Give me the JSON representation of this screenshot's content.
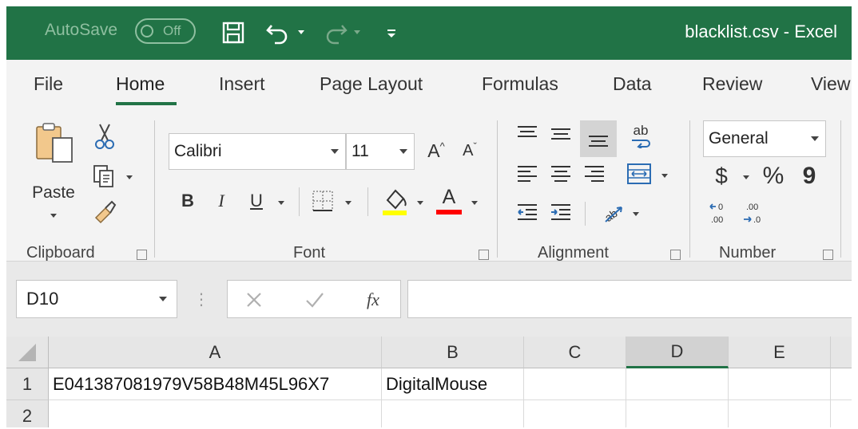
{
  "titlebar": {
    "autosave_label": "AutoSave",
    "autosave_state": "Off",
    "document_title": "blacklist.csv  -  Excel"
  },
  "tabs": [
    "File",
    "Home",
    "Insert",
    "Page Layout",
    "Formulas",
    "Data",
    "Review",
    "View"
  ],
  "active_tab": "Home",
  "ribbon": {
    "clipboard": {
      "paste_label": "Paste",
      "group_label": "Clipboard"
    },
    "font": {
      "font_name": "Calibri",
      "font_size": "11",
      "group_label": "Font",
      "bold": "B",
      "italic": "I",
      "underline": "U",
      "font_color_glyph": "A",
      "grow_glyph": "A",
      "shrink_glyph": "A",
      "highlight_color": "#ffff00",
      "font_color": "#ff0000"
    },
    "alignment": {
      "group_label": "Alignment",
      "wrap_glyph": "ab"
    },
    "number": {
      "format": "General",
      "group_label": "Number",
      "currency": "$",
      "percent": "%",
      "comma": "9"
    }
  },
  "formula_bar": {
    "name_box": "D10",
    "fx_label": "fx",
    "formula": ""
  },
  "sheet": {
    "columns": [
      "A",
      "B",
      "C",
      "D",
      "E"
    ],
    "selected_column": "D",
    "rows": [
      {
        "number": "1",
        "cells": [
          "E041387081979V58B48M45L96X7",
          "DigitalMouse",
          "",
          "",
          ""
        ]
      },
      {
        "number": "2",
        "cells": [
          "",
          "",
          "",
          "",
          ""
        ]
      }
    ]
  },
  "colors": {
    "accent": "#217346",
    "ribbon_bg": "#f3f3f3"
  }
}
